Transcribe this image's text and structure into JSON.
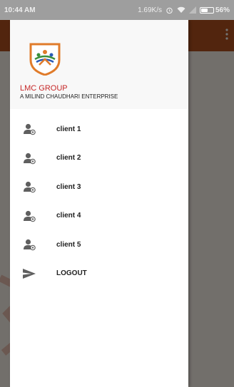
{
  "status_bar": {
    "time": "10:44 AM",
    "speed": "1.69K/s",
    "battery": "56%",
    "battery_level": 0.56
  },
  "drawer": {
    "brand_name": "LMC GROUP",
    "brand_tagline": "A MILIND CHAUDHARI ENTERPRISE",
    "menu": [
      {
        "label": "client 1",
        "icon": "client-user-icon"
      },
      {
        "label": "client 2",
        "icon": "client-user-icon"
      },
      {
        "label": "client 3",
        "icon": "client-user-icon"
      },
      {
        "label": "client 4",
        "icon": "client-user-icon"
      },
      {
        "label": "client 5",
        "icon": "client-user-icon"
      },
      {
        "label": "LOGOUT",
        "icon": "send-icon"
      }
    ]
  },
  "colors": {
    "toolbar": "#b5531f",
    "brand_red": "#c62828",
    "logo_orange": "#e07b2a",
    "logo_green": "#3a8f3a",
    "logo_blue": "#2a5bb8"
  }
}
